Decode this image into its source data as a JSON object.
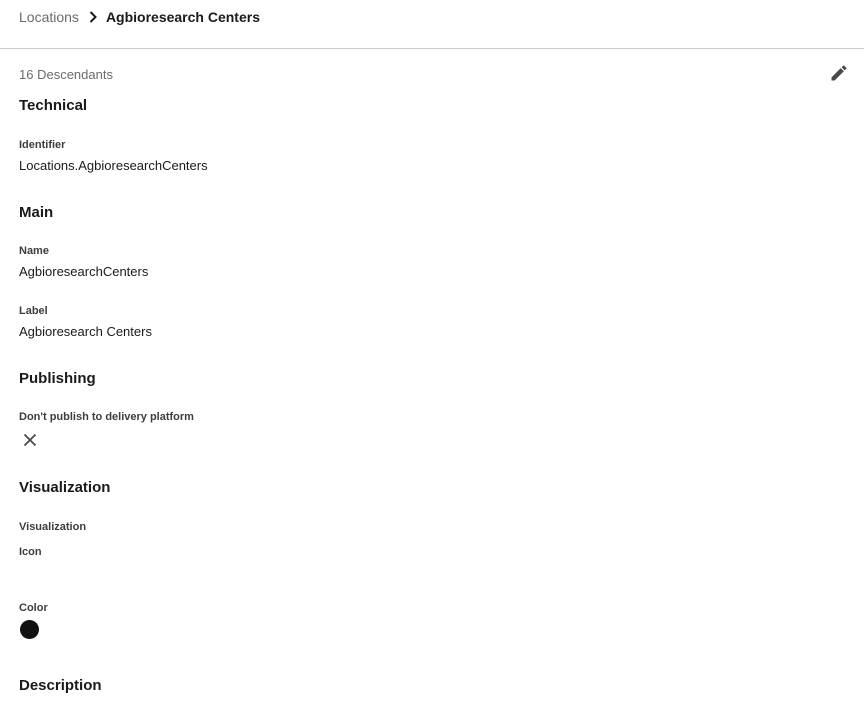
{
  "breadcrumb": {
    "parent": "Locations",
    "separator_icon": "chevron-right-icon",
    "current": "Agbioresearch Centers"
  },
  "edit_icon": "pencil-icon",
  "descendants": "16 Descendants",
  "sections": {
    "technical": {
      "title": "Technical",
      "identifier_label": "Identifier",
      "identifier_value": "Locations.AgbioresearchCenters"
    },
    "main": {
      "title": "Main",
      "name_label": "Name",
      "name_value": "AgbioresearchCenters",
      "label_label": "Label",
      "label_value": "Agbioresearch Centers"
    },
    "publishing": {
      "title": "Publishing",
      "dont_publish_label": "Don't publish to delivery platform",
      "dont_publish_icon": "close-icon"
    },
    "visualization": {
      "title": "Visualization",
      "visualization_label": "Visualization",
      "icon_label": "Icon",
      "color_label": "Color",
      "color_value": "#111111"
    },
    "description": {
      "title": "Description"
    }
  }
}
